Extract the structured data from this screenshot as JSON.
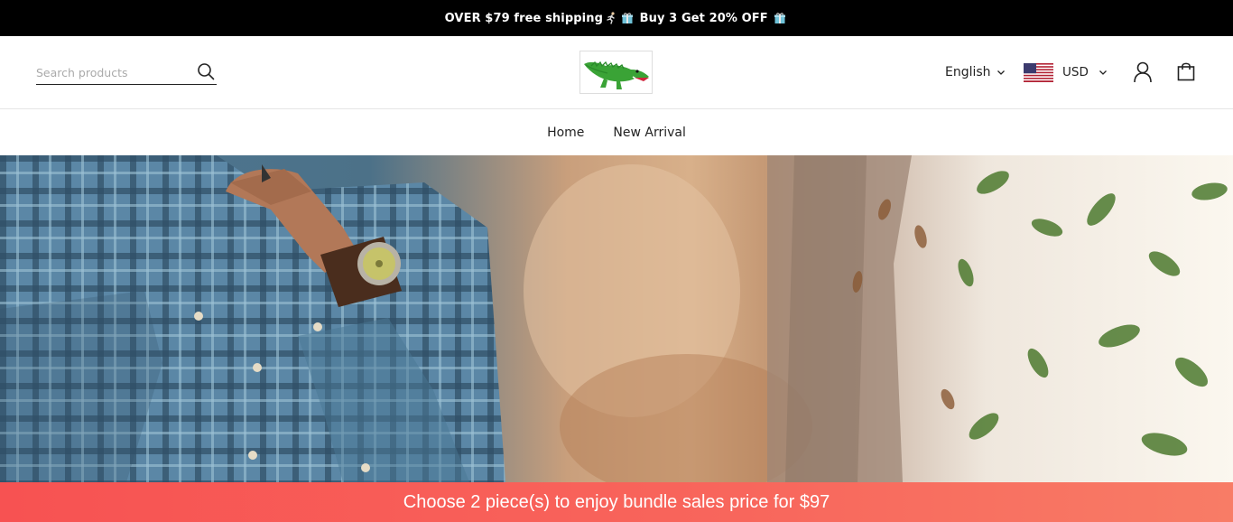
{
  "announcement": {
    "part1": "OVER $79 free shipping",
    "part2": " Buy 3 Get 20% OFF ",
    "icons": [
      "runner-icon",
      "gift-icon",
      "gift-icon"
    ]
  },
  "header": {
    "search_placeholder": "Search products",
    "language": "English",
    "currency": "USD"
  },
  "nav": {
    "items": [
      "Home",
      "New Arrival"
    ]
  },
  "bundle_bar": {
    "text": "Choose 2 piece(s) to enjoy bundle sales price for $97"
  },
  "colors": {
    "announcement_bg": "#000000",
    "bundle_bar_start": "#f75252",
    "bundle_bar_end": "#f87c66",
    "logo_green": "#3aa336"
  }
}
